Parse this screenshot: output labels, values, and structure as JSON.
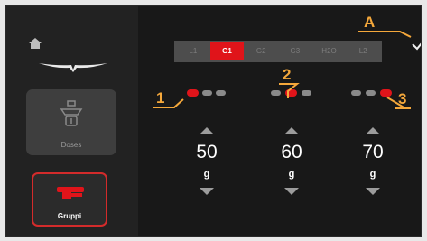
{
  "sidebar": {
    "home_icon": "home-icon",
    "logo_icon": "brand-wings-icon",
    "dose_label": "Doses",
    "dose_icon": "portafilter-dose-icon",
    "gruppi_label": "Gruppi",
    "gruppi_icon": "group-head-icon",
    "accent_color": "#d32b2b"
  },
  "tabs": [
    {
      "label": "L1",
      "active": false
    },
    {
      "label": "G1",
      "active": true
    },
    {
      "label": "G2",
      "active": false
    },
    {
      "label": "G3",
      "active": false
    },
    {
      "label": "H2O",
      "active": false
    },
    {
      "label": "L2",
      "active": false
    }
  ],
  "confirm_icon": "checkmark-icon",
  "doses": [
    {
      "selected_dot": 1,
      "value": "50",
      "unit": "g"
    },
    {
      "selected_dot": 2,
      "value": "60",
      "unit": "g"
    },
    {
      "selected_dot": 3,
      "value": "70",
      "unit": "g"
    }
  ],
  "callouts": {
    "a": "A",
    "one": "1",
    "two": "2",
    "three": "3"
  },
  "colors": {
    "accent_red": "#e0141a",
    "callout": "#f5a83b",
    "background": "#181818"
  }
}
